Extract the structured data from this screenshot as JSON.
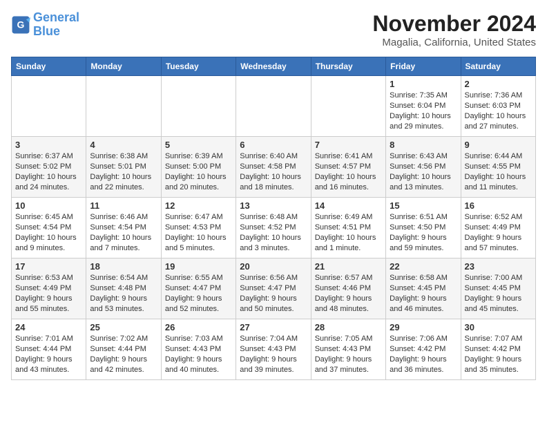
{
  "logo": {
    "line1": "General",
    "line2": "Blue"
  },
  "title": "November 2024",
  "subtitle": "Magalia, California, United States",
  "weekdays": [
    "Sunday",
    "Monday",
    "Tuesday",
    "Wednesday",
    "Thursday",
    "Friday",
    "Saturday"
  ],
  "weeks": [
    [
      {
        "day": "",
        "info": ""
      },
      {
        "day": "",
        "info": ""
      },
      {
        "day": "",
        "info": ""
      },
      {
        "day": "",
        "info": ""
      },
      {
        "day": "",
        "info": ""
      },
      {
        "day": "1",
        "info": "Sunrise: 7:35 AM\nSunset: 6:04 PM\nDaylight: 10 hours and 29 minutes."
      },
      {
        "day": "2",
        "info": "Sunrise: 7:36 AM\nSunset: 6:03 PM\nDaylight: 10 hours and 27 minutes."
      }
    ],
    [
      {
        "day": "3",
        "info": "Sunrise: 6:37 AM\nSunset: 5:02 PM\nDaylight: 10 hours and 24 minutes."
      },
      {
        "day": "4",
        "info": "Sunrise: 6:38 AM\nSunset: 5:01 PM\nDaylight: 10 hours and 22 minutes."
      },
      {
        "day": "5",
        "info": "Sunrise: 6:39 AM\nSunset: 5:00 PM\nDaylight: 10 hours and 20 minutes."
      },
      {
        "day": "6",
        "info": "Sunrise: 6:40 AM\nSunset: 4:58 PM\nDaylight: 10 hours and 18 minutes."
      },
      {
        "day": "7",
        "info": "Sunrise: 6:41 AM\nSunset: 4:57 PM\nDaylight: 10 hours and 16 minutes."
      },
      {
        "day": "8",
        "info": "Sunrise: 6:43 AM\nSunset: 4:56 PM\nDaylight: 10 hours and 13 minutes."
      },
      {
        "day": "9",
        "info": "Sunrise: 6:44 AM\nSunset: 4:55 PM\nDaylight: 10 hours and 11 minutes."
      }
    ],
    [
      {
        "day": "10",
        "info": "Sunrise: 6:45 AM\nSunset: 4:54 PM\nDaylight: 10 hours and 9 minutes."
      },
      {
        "day": "11",
        "info": "Sunrise: 6:46 AM\nSunset: 4:54 PM\nDaylight: 10 hours and 7 minutes."
      },
      {
        "day": "12",
        "info": "Sunrise: 6:47 AM\nSunset: 4:53 PM\nDaylight: 10 hours and 5 minutes."
      },
      {
        "day": "13",
        "info": "Sunrise: 6:48 AM\nSunset: 4:52 PM\nDaylight: 10 hours and 3 minutes."
      },
      {
        "day": "14",
        "info": "Sunrise: 6:49 AM\nSunset: 4:51 PM\nDaylight: 10 hours and 1 minute."
      },
      {
        "day": "15",
        "info": "Sunrise: 6:51 AM\nSunset: 4:50 PM\nDaylight: 9 hours and 59 minutes."
      },
      {
        "day": "16",
        "info": "Sunrise: 6:52 AM\nSunset: 4:49 PM\nDaylight: 9 hours and 57 minutes."
      }
    ],
    [
      {
        "day": "17",
        "info": "Sunrise: 6:53 AM\nSunset: 4:49 PM\nDaylight: 9 hours and 55 minutes."
      },
      {
        "day": "18",
        "info": "Sunrise: 6:54 AM\nSunset: 4:48 PM\nDaylight: 9 hours and 53 minutes."
      },
      {
        "day": "19",
        "info": "Sunrise: 6:55 AM\nSunset: 4:47 PM\nDaylight: 9 hours and 52 minutes."
      },
      {
        "day": "20",
        "info": "Sunrise: 6:56 AM\nSunset: 4:47 PM\nDaylight: 9 hours and 50 minutes."
      },
      {
        "day": "21",
        "info": "Sunrise: 6:57 AM\nSunset: 4:46 PM\nDaylight: 9 hours and 48 minutes."
      },
      {
        "day": "22",
        "info": "Sunrise: 6:58 AM\nSunset: 4:45 PM\nDaylight: 9 hours and 46 minutes."
      },
      {
        "day": "23",
        "info": "Sunrise: 7:00 AM\nSunset: 4:45 PM\nDaylight: 9 hours and 45 minutes."
      }
    ],
    [
      {
        "day": "24",
        "info": "Sunrise: 7:01 AM\nSunset: 4:44 PM\nDaylight: 9 hours and 43 minutes."
      },
      {
        "day": "25",
        "info": "Sunrise: 7:02 AM\nSunset: 4:44 PM\nDaylight: 9 hours and 42 minutes."
      },
      {
        "day": "26",
        "info": "Sunrise: 7:03 AM\nSunset: 4:43 PM\nDaylight: 9 hours and 40 minutes."
      },
      {
        "day": "27",
        "info": "Sunrise: 7:04 AM\nSunset: 4:43 PM\nDaylight: 9 hours and 39 minutes."
      },
      {
        "day": "28",
        "info": "Sunrise: 7:05 AM\nSunset: 4:43 PM\nDaylight: 9 hours and 37 minutes."
      },
      {
        "day": "29",
        "info": "Sunrise: 7:06 AM\nSunset: 4:42 PM\nDaylight: 9 hours and 36 minutes."
      },
      {
        "day": "30",
        "info": "Sunrise: 7:07 AM\nSunset: 4:42 PM\nDaylight: 9 hours and 35 minutes."
      }
    ]
  ]
}
